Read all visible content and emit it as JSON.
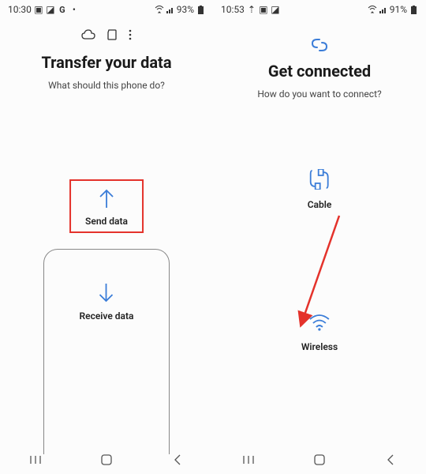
{
  "left": {
    "status": {
      "time": "10:30",
      "battery": "93%"
    },
    "title": "Transfer your data",
    "subtitle": "What should this phone do?",
    "send_label": "Send data",
    "receive_label": "Receive data"
  },
  "right": {
    "status": {
      "time": "10:53",
      "battery": "91%"
    },
    "title": "Get connected",
    "subtitle": "How do you want to connect?",
    "cable_label": "Cable",
    "wireless_label": "Wireless"
  },
  "colors": {
    "accent": "#3b7dd8",
    "highlight": "#e4322b"
  }
}
